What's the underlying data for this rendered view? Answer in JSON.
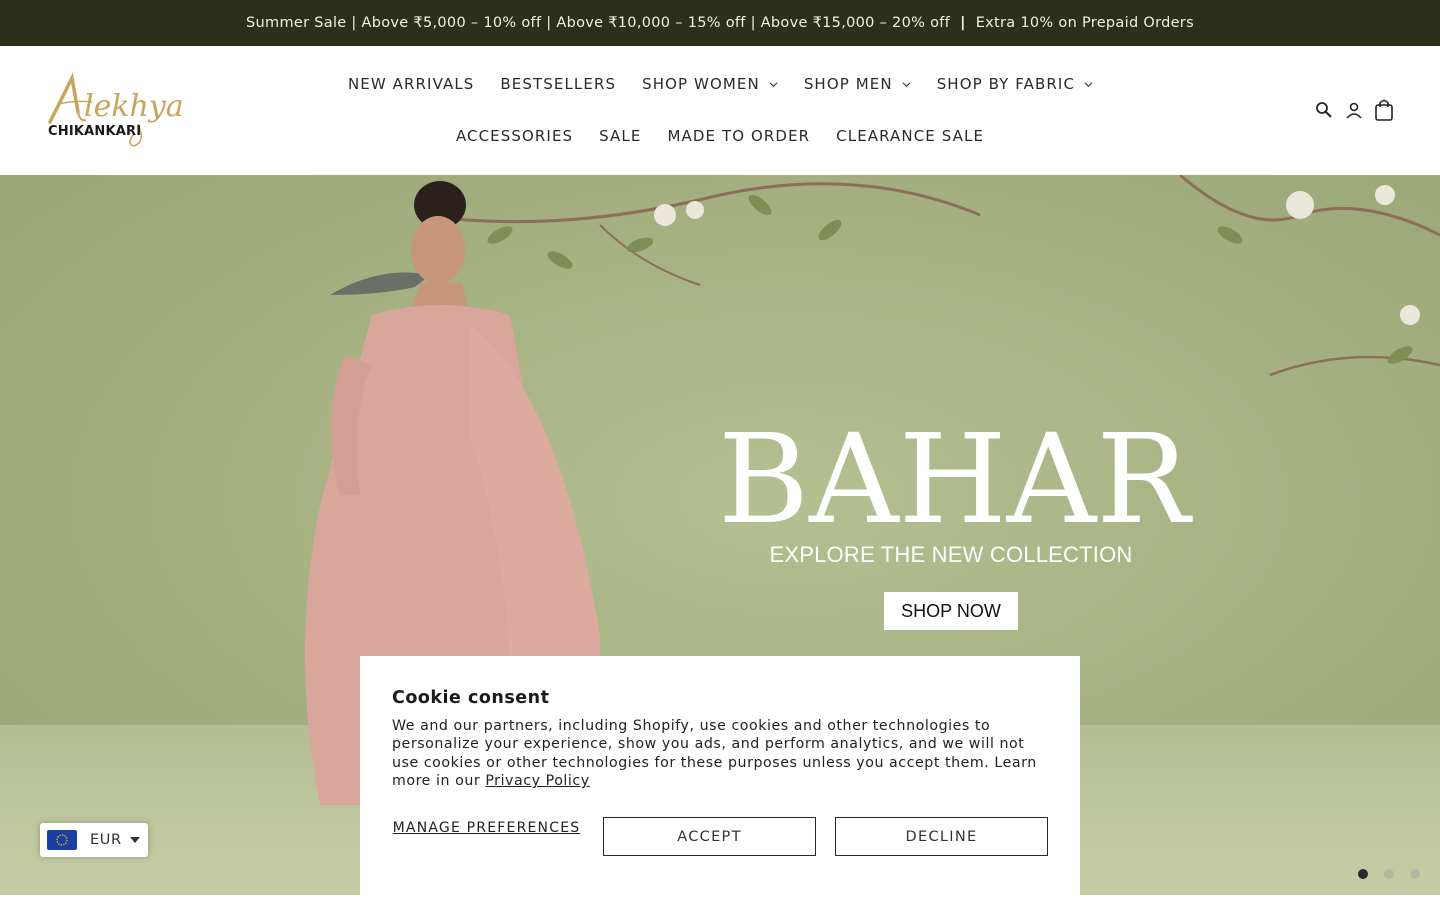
{
  "announcement": {
    "text": "Summer Sale | Above ₹5,000 – 10% off | Above ₹10,000 – 15% off | Above ₹15,000 – 20% off",
    "separator": "|",
    "extra": "Extra 10% on Prepaid Orders"
  },
  "logo": {
    "script_text": "Alekhya",
    "word_text": "CHIKANKARI",
    "brand_color": "#c9a45c"
  },
  "nav": {
    "row1": [
      {
        "label": "NEW ARRIVALS"
      },
      {
        "label": "BESTSELLERS"
      },
      {
        "label": "SHOP WOMEN",
        "dropdown": true
      },
      {
        "label": "SHOP MEN",
        "dropdown": true
      },
      {
        "label": "SHOP BY FABRIC",
        "dropdown": true
      }
    ],
    "row2": [
      {
        "label": "ACCESSORIES"
      },
      {
        "label": "SALE"
      },
      {
        "label": "MADE TO ORDER"
      },
      {
        "label": "CLEARANCE SALE"
      }
    ]
  },
  "header_icons": [
    "search-icon",
    "account-icon",
    "cart-icon"
  ],
  "hero": {
    "title": "BAHAR",
    "subtitle": "EXPLORE THE NEW COLLECTION",
    "cta": "SHOP NOW",
    "background_color": "#a7b283",
    "slides_count": 3,
    "active_slide": 1
  },
  "currency_selector": {
    "code": "EUR",
    "flag": "eu-flag-icon"
  },
  "cookie": {
    "title": "Cookie consent",
    "body": "We and our partners, including Shopify, use cookies and other technologies to personalize your experience, show you ads, and perform analytics, and we will not use cookies or other technologies for these purposes unless you accept them. Learn more in our",
    "link": "Privacy Policy",
    "manage": "MANAGE PREFERENCES",
    "accept": "ACCEPT",
    "decline": "DECLINE"
  },
  "colors": {
    "topbar": "#2c2f1a",
    "accent_gold": "#c9a45c",
    "dress_pink": "#d9a69c"
  }
}
